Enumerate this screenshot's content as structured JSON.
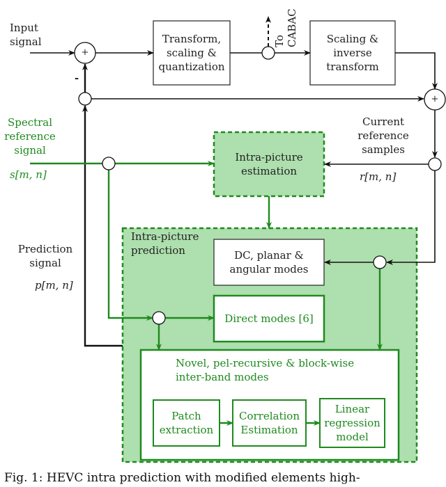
{
  "colors": {
    "black": "#111111",
    "green": "#1e8a1e",
    "green_fill": "#aedfae",
    "white": "#ffffff"
  },
  "labels": {
    "input_signal": [
      "Input",
      "signal"
    ],
    "to_cabac": [
      "To",
      "CABAC"
    ],
    "spectral_reference_signal": [
      "Spectral",
      "reference",
      "signal"
    ],
    "spectral_math": "s[m, n]",
    "current_reference_samples": [
      "Current",
      "reference",
      "samples"
    ],
    "current_math": "r[m, n]",
    "prediction_signal": [
      "Prediction",
      "signal"
    ],
    "prediction_math": "p[m, n]",
    "minus_sign": "-",
    "plus_sign": "+"
  },
  "blocks": {
    "transform": [
      "Transform,",
      "scaling &",
      "quantization"
    ],
    "scaling_inverse": [
      "Scaling &",
      "inverse",
      "transform"
    ],
    "intra_estimation": [
      "Intra-picture",
      "estimation"
    ],
    "intra_prediction_group": [
      "Intra-picture",
      "prediction"
    ],
    "dc_planar_angular": [
      "DC, planar &",
      "angular modes"
    ],
    "direct_modes": "Direct modes [6]",
    "novel_modes": [
      "Novel, pel-recursive & block-wise",
      "inter-band modes"
    ],
    "patch_extraction": [
      "Patch",
      "extraction"
    ],
    "correlation_estimation": [
      "Correlation",
      "Estimation"
    ],
    "linear_regression": [
      "Linear",
      "regression",
      "model"
    ]
  },
  "caption": "Fig. 1: HEVC intra prediction with modified elements high-"
}
